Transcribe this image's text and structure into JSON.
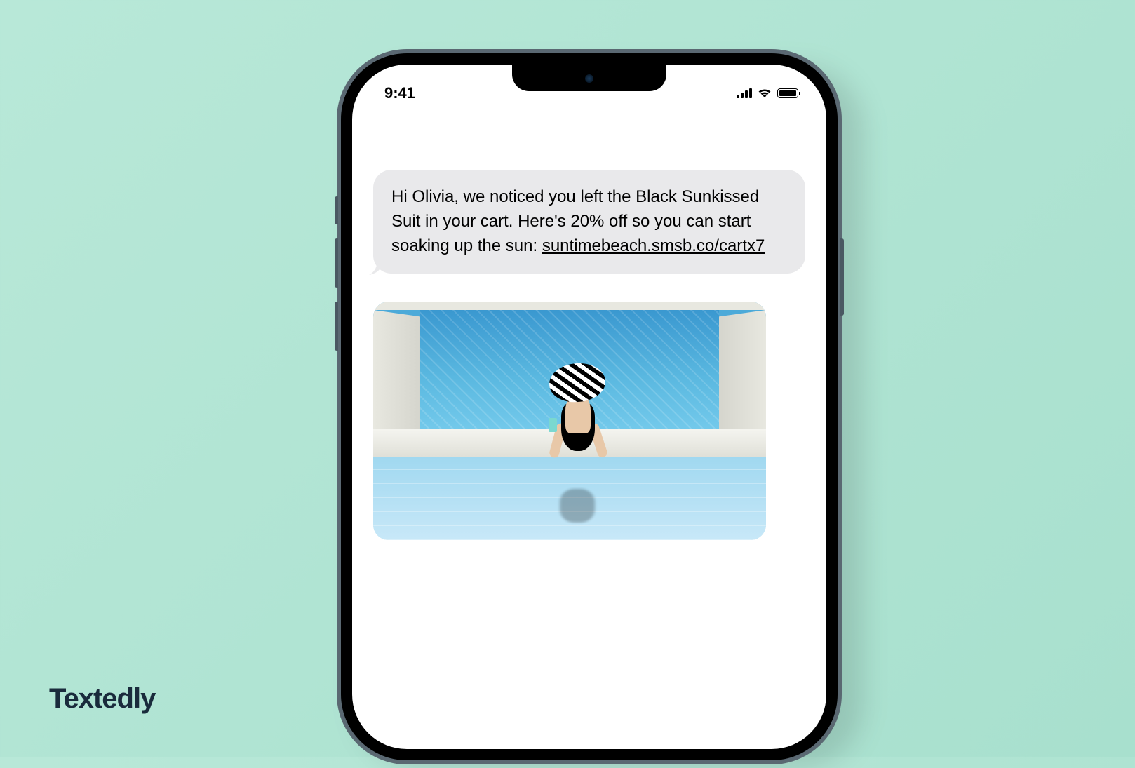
{
  "brand": "Textedly",
  "status": {
    "time": "9:41"
  },
  "message": {
    "text": "Hi Olivia, we noticed you left the Black Sunkissed Suit in your cart. Here's 20% off so you can start soaking up the sun: ",
    "link": "suntimebeach.smsb.co/cartx7"
  },
  "image_alt": "Woman in black swimsuit and striped hat sitting at pool edge"
}
